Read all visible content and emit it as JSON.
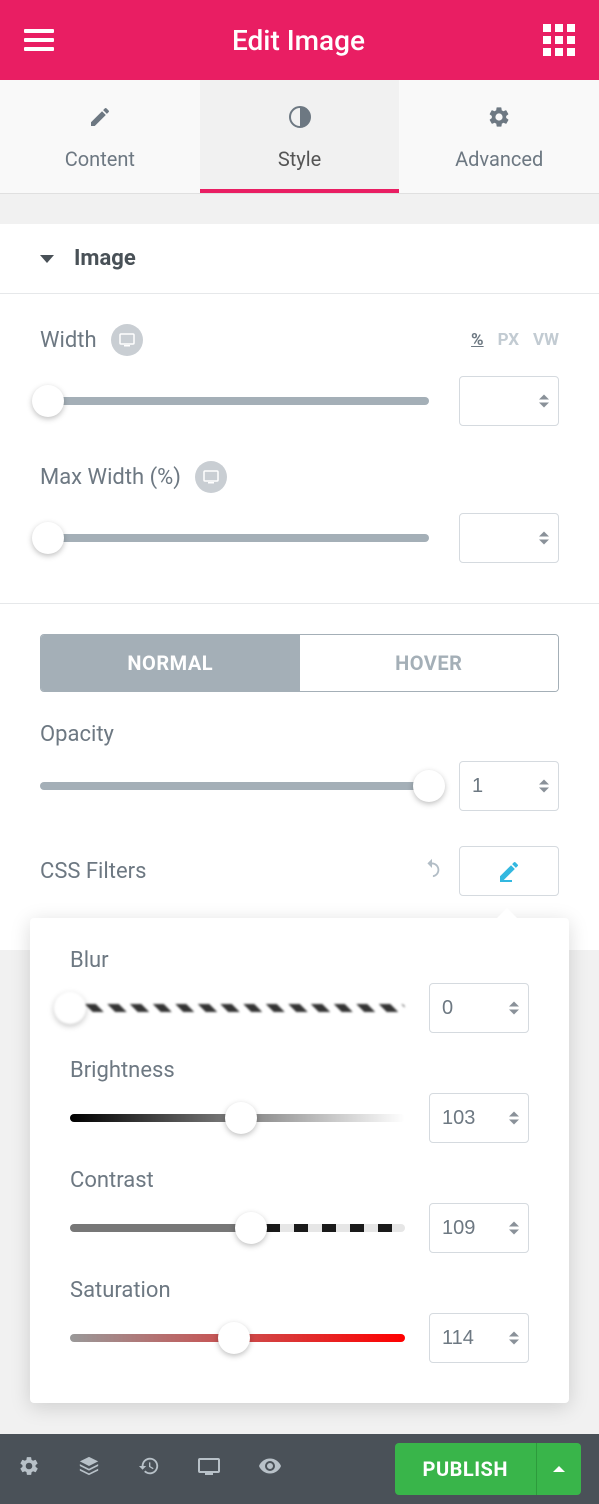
{
  "header": {
    "title": "Edit Image"
  },
  "tabs": {
    "content": "Content",
    "style": "Style",
    "advanced": "Advanced",
    "active": "style"
  },
  "section": {
    "title": "Image"
  },
  "width": {
    "label": "Width",
    "units": [
      "%",
      "PX",
      "VW"
    ],
    "active_unit": "%",
    "value": ""
  },
  "max_width": {
    "label": "Max Width (%)",
    "value": ""
  },
  "state_tabs": {
    "normal": "NORMAL",
    "hover": "HOVER"
  },
  "opacity": {
    "label": "Opacity",
    "value": "1",
    "percent": 100
  },
  "css_filters": {
    "label": "CSS Filters"
  },
  "filters": {
    "blur": {
      "label": "Blur",
      "value": "0",
      "percent": 0
    },
    "brightness": {
      "label": "Brightness",
      "value": "103",
      "percent": 51
    },
    "contrast": {
      "label": "Contrast",
      "value": "109",
      "percent": 54
    },
    "saturation": {
      "label": "Saturation",
      "value": "114",
      "percent": 49
    }
  },
  "footer": {
    "publish": "PUBLISH"
  }
}
